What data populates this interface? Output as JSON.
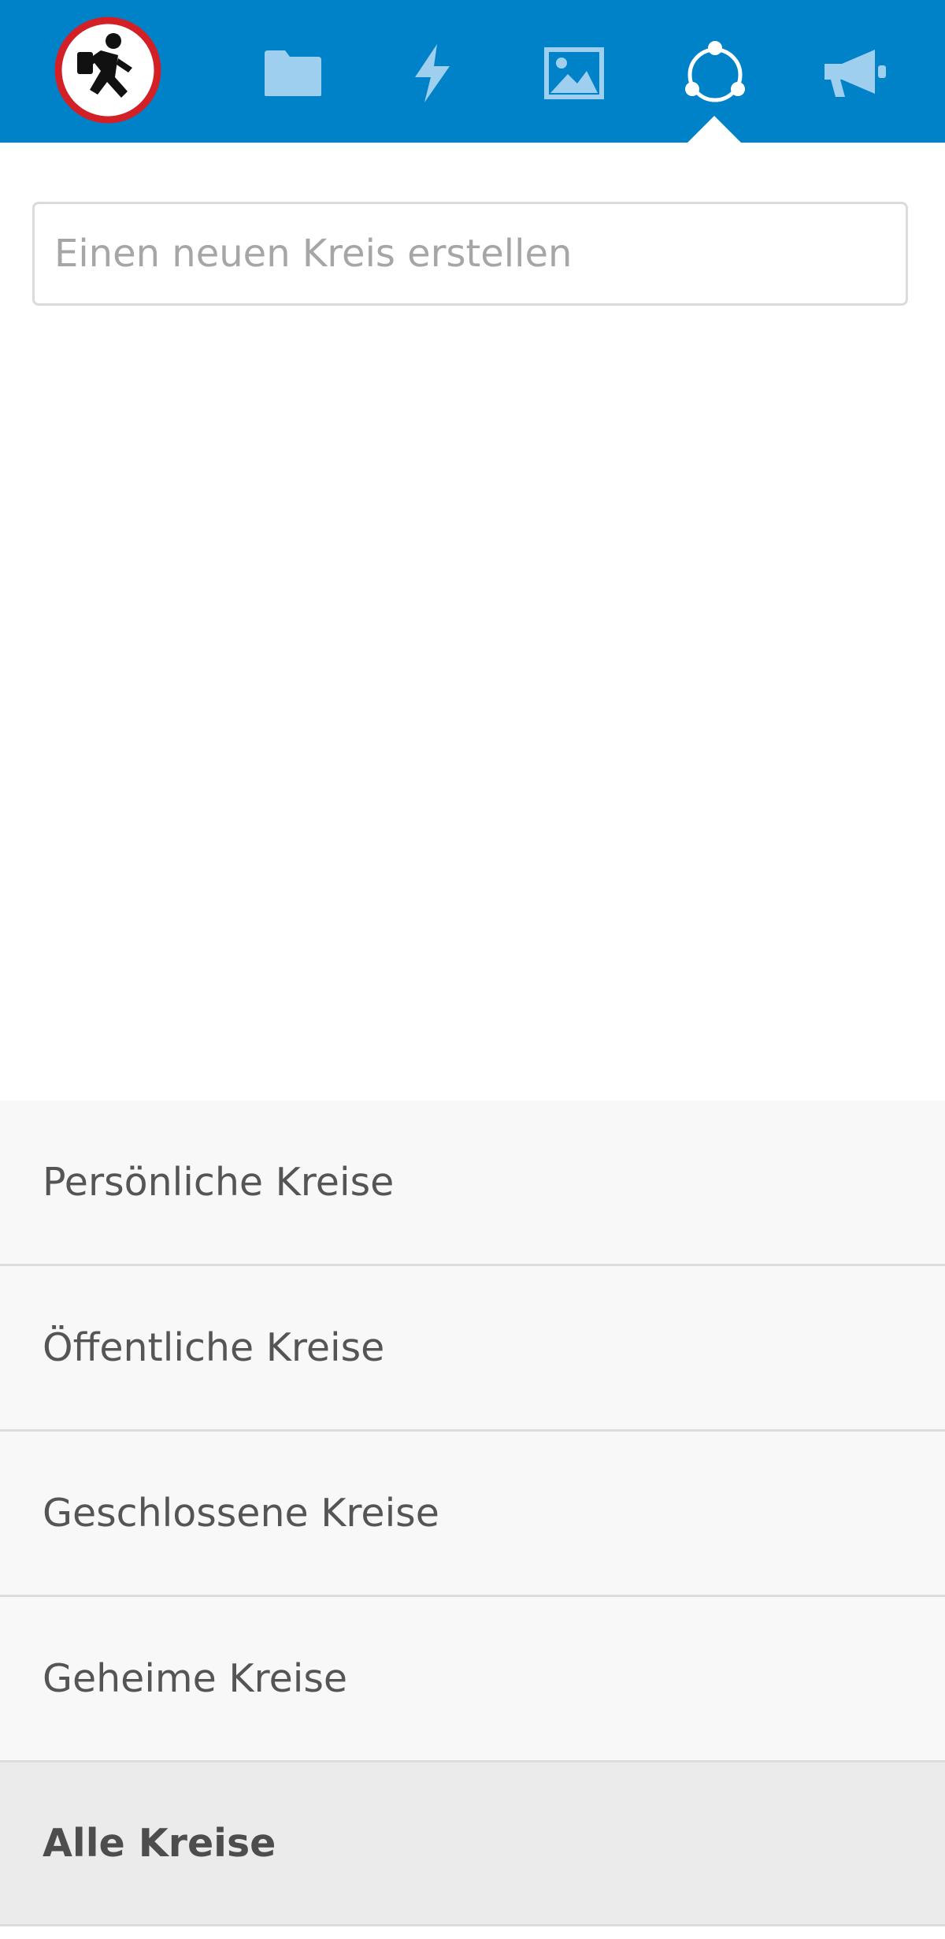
{
  "header": {
    "background_color": "#0082c9",
    "logo_icon": "running-person-prohibition-logo",
    "nav": [
      {
        "icon": "folder-icon",
        "name": "Files",
        "active": false
      },
      {
        "icon": "lightning-icon",
        "name": "Activity",
        "active": false
      },
      {
        "icon": "image-icon",
        "name": "Gallery",
        "active": false
      },
      {
        "icon": "circles-icon",
        "name": "Circles",
        "active": true
      },
      {
        "icon": "megaphone-icon",
        "name": "Announcements",
        "active": false
      }
    ]
  },
  "new_circle": {
    "placeholder": "Einen neuen Kreis erstellen",
    "value": ""
  },
  "filters": {
    "items": [
      {
        "label": "Persönliche Kreise",
        "active": false
      },
      {
        "label": "Öffentliche Kreise",
        "active": false
      },
      {
        "label": "Geschlossene Kreise",
        "active": false
      },
      {
        "label": "Geheime Kreise",
        "active": false
      },
      {
        "label": "Alle Kreise",
        "active": true
      }
    ]
  }
}
